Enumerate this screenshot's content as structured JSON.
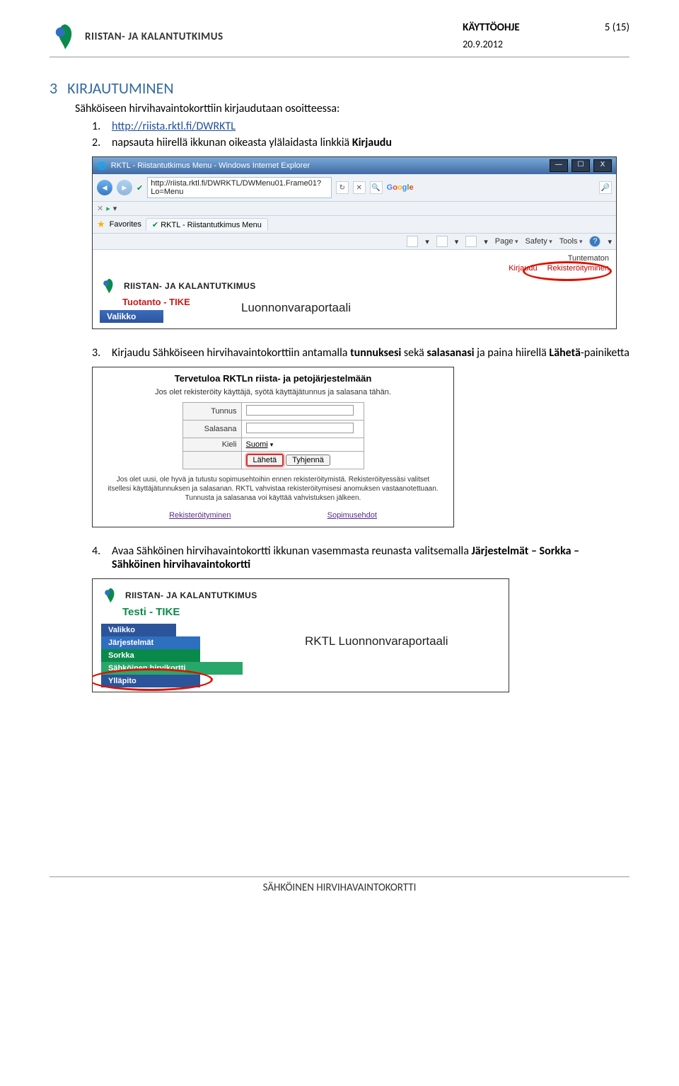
{
  "header": {
    "brand": "RIISTAN- JA KALANTUTKIMUS",
    "doc_title": "KÄYTTÖOHJE",
    "page_num": "5 (15)",
    "date": "20.9.2012"
  },
  "section": {
    "num": "3",
    "title": "KIRJAUTUMINEN"
  },
  "intro": "Sähköiseen hirvihavaintokorttiin kirjaudutaan osoitteessa:",
  "steps": {
    "s1": {
      "num": "1.",
      "link": "http://riista.rktl.fi/DWRKTL"
    },
    "s2": {
      "num": "2.",
      "before": "napsauta hiirellä ikkunan oikeasta ylälaidasta linkkiä ",
      "bold": "Kirjaudu"
    },
    "s3": {
      "num": "3.",
      "a": "Kirjaudu Sähköiseen hirvihavaintokorttiin antamalla ",
      "b": "tunnuksesi",
      "c": " sekä ",
      "d": "salasanasi",
      "e": " ja paina hiirellä ",
      "f": "Lähetä",
      "g": "-painiketta"
    },
    "s4": {
      "num": "4.",
      "a": "Avaa Sähköinen hirvihavaintokortti ikkunan vasemmasta reunasta valitsemalla ",
      "b": "Järjestelmät – Sorkka – Sähköinen hirvihavaintokortti"
    }
  },
  "shot1": {
    "wintitle": "RKTL - Riistantutkimus Menu - Windows Internet Explorer",
    "url": "http://riista.rktl.fi/DWRKTL/DWMenu01.Frame01?Lo=Menu",
    "google": "Google",
    "favorites": "Favorites",
    "tab": "RKTL - Riistantutkimus Menu",
    "menu_page": "Page",
    "menu_safety": "Safety",
    "menu_tools": "Tools",
    "tuntematon": "Tuntematon",
    "kirjaudu": "Kirjaudu",
    "rekister": "Rekisteröityminen",
    "brand": "RIISTAN- JA KALANTUTKIMUS",
    "tuotanto": "Tuotanto - TIKE",
    "valikko": "Valikko",
    "portal": "Luonnonvaraportaali"
  },
  "shot2": {
    "title": "Tervetuloa RKTLn riista- ja petojärjestelmään",
    "sub": "Jos olet rekisteröity käyttäjä, syötä käyttäjätunnus ja salasana tähän.",
    "lbl_tunnus": "Tunnus",
    "lbl_salasana": "Salasana",
    "lbl_kieli": "Kieli",
    "kieli_val": "Suomi",
    "btn_laheta": "Lähetä",
    "btn_tyhjenna": "Tyhjennä",
    "foot": "Jos olet uusi, ole hyvä ja tutustu sopimusehtoihin ennen rekisteröitymistä. Rekisteröityessäsi valitset itsellesi käyttäjätunnuksen ja salasanan. RKTL vahvistaa rekisteröitymisesi anomuksen vastaanotettuaan. Tunnusta ja salasanaa voi käyttää vahvistuksen jälkeen.",
    "link1": "Rekisteröityminen",
    "link2": "Sopimusehdot"
  },
  "shot3": {
    "brand": "RIISTAN- JA KALANTUTKIMUS",
    "testi": "Testi - TIKE",
    "valikko": "Valikko",
    "jarjestelmat": "Järjestelmät",
    "sorkka": "Sorkka",
    "hirvikortti": "Sähköinen hirvikortti",
    "yllapito": "Ylläpito",
    "portal": "RKTL Luonnonvaraportaali"
  },
  "footer": "SÄHKÖINEN HIRVIHAVAINTOKORTTI"
}
